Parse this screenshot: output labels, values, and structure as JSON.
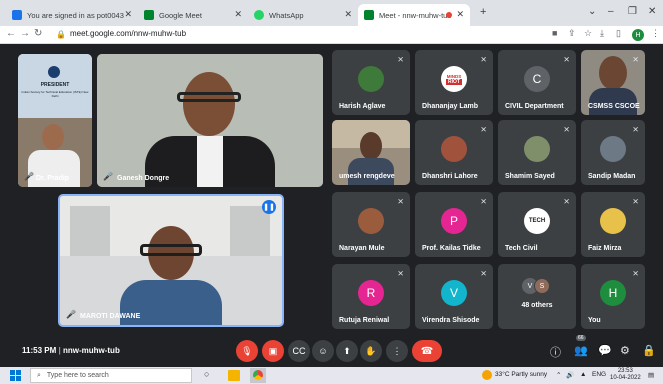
{
  "browser": {
    "tabs": [
      {
        "title": "You are signed in as pot0043",
        "favicon_color": "#1a73e8"
      },
      {
        "title": "Google Meet",
        "favicon_color": "#00832d"
      },
      {
        "title": "WhatsApp",
        "favicon_color": "#25d366"
      },
      {
        "title": "Meet - nnw-muhw-tub",
        "favicon_color": "#00832d",
        "active": true
      }
    ],
    "new_tab": "+",
    "url": "meet.google.com/nnw-muhw-tub",
    "window_controls": [
      "⌄",
      "–",
      "❐",
      "✕"
    ],
    "profile_initial": "H"
  },
  "meet": {
    "participants": [
      {
        "name": "Harish Aglave",
        "type": "photo"
      },
      {
        "name": "Dhananjay Lamb",
        "type": "logo",
        "logo_text": [
          "MINDS",
          "RIOT"
        ]
      },
      {
        "name": "CIVIL Department",
        "type": "initial",
        "initial": "C",
        "color": "#5f6368"
      },
      {
        "name": "CSMSS CSCOE",
        "type": "video"
      },
      {
        "name": "umesh rengdeve",
        "type": "video"
      },
      {
        "name": "Dhanshri Lahore",
        "type": "photo"
      },
      {
        "name": "Shamim Sayed",
        "type": "photo"
      },
      {
        "name": "Sandip Madan",
        "type": "photo"
      },
      {
        "name": "Narayan Mule",
        "type": "photo"
      },
      {
        "name": "Prof. Kailas Tidke",
        "type": "initial",
        "initial": "P",
        "color": "#e52592"
      },
      {
        "name": "Tech Civil",
        "type": "logo",
        "logo_text": [
          "TECH"
        ]
      },
      {
        "name": "Faiz Mirza",
        "type": "photo"
      },
      {
        "name": "Rutuja Reniwal",
        "type": "initial",
        "initial": "R",
        "color": "#e52592"
      },
      {
        "name": "Virendra Shisode",
        "type": "initial",
        "initial": "V",
        "color": "#12b5cb"
      },
      {
        "name": "48 others",
        "type": "others",
        "initials": [
          "V",
          "S"
        ]
      },
      {
        "name": "You",
        "type": "initial",
        "initial": "H",
        "color": "#1e8e3e"
      }
    ],
    "main_tiles": [
      {
        "name": "Ganesh Dongre"
      },
      {
        "name": "Dr. Pradip"
      },
      {
        "name": "MAROTI DAWANE"
      }
    ],
    "presentation_text": "PRESIDENT",
    "presentation_subtext": "Indian Society for Technical Education (ISTE) New Delhi",
    "meeting_time": "11:53 PM",
    "meeting_code": "nnw-muhw-tub",
    "participant_count": "66"
  },
  "taskbar": {
    "search_placeholder": "Type here to search",
    "weather": "33°C  Partly sunny",
    "language": "ENG",
    "time": "23:53",
    "date": "10-04-2022"
  }
}
